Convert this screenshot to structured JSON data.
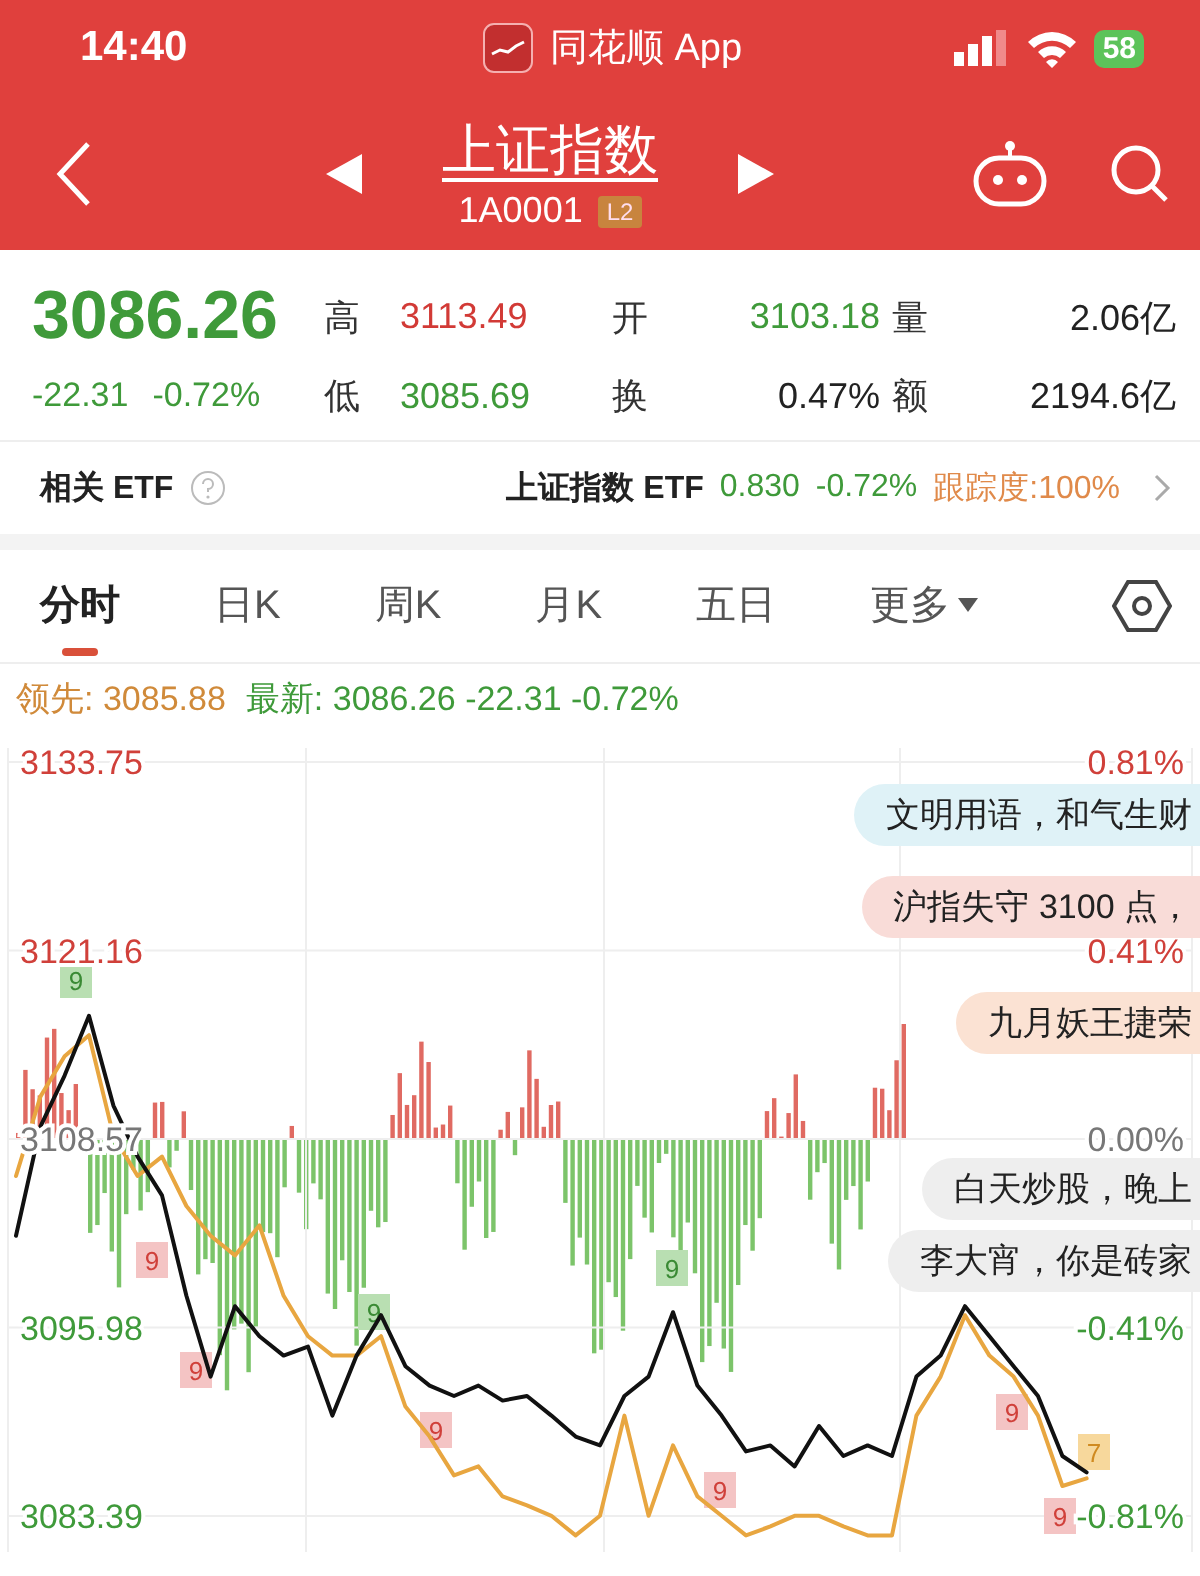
{
  "status_bar": {
    "time": "14:40",
    "app": "同花顺 App",
    "battery": "58"
  },
  "nav": {
    "title": "上证指数",
    "code": "1A0001",
    "badge": "L2"
  },
  "quote": {
    "price": "3086.26",
    "change": "-22.31",
    "change_pct": "-0.72%",
    "color": "#3f9a3a",
    "fields": [
      {
        "label": "高",
        "value": "3113.49",
        "color": "#d23a36"
      },
      {
        "label": "开",
        "value": "3103.18",
        "color": "#3f9a3a"
      },
      {
        "label": "量",
        "value": "2.06亿",
        "color": "#222222"
      },
      {
        "label": "低",
        "value": "3085.69",
        "color": "#3f9a3a"
      },
      {
        "label": "换",
        "value": "0.47%",
        "color": "#222222"
      },
      {
        "label": "额",
        "value": "2194.6亿",
        "color": "#222222"
      }
    ]
  },
  "etf": {
    "label": "相关 ETF",
    "name": "上证指数 ETF",
    "price": "0.830",
    "change_pct": "-0.72%",
    "tracking": "跟踪度:100%"
  },
  "tabs": [
    {
      "label": "分时",
      "selected": true,
      "kind": "tab"
    },
    {
      "label": "日K",
      "selected": false,
      "kind": "tab"
    },
    {
      "label": "周K",
      "selected": false,
      "kind": "tab"
    },
    {
      "label": "月K",
      "selected": false,
      "kind": "tab"
    },
    {
      "label": "五日",
      "selected": false,
      "kind": "tab"
    },
    {
      "label": "更多",
      "selected": false,
      "kind": "menu"
    }
  ],
  "chart": {
    "legend": [
      {
        "values": [
          "3085.88"
        ],
        "color": "#d08a3a"
      },
      {
        "values": [
          "3086.26",
          "-22.31",
          "-0.72%"
        ],
        "color": "#3f9a3a"
      }
    ],
    "pct_labels": [
      "0.81%",
      "0.41%",
      "0.00%",
      "-0.41%",
      "-0.81%"
    ],
    "markers": [
      {
        "label": "9",
        "color": "#b9dfb2"
      },
      {
        "label": "9",
        "color": "#f4c4c4"
      },
      {
        "label": "9",
        "color": "#f4c4c4"
      },
      {
        "label": "9",
        "color": "#b9dfb2"
      },
      {
        "label": "9",
        "color": "#f4c4c4"
      },
      {
        "label": "9",
        "color": "#b9dfb2"
      },
      {
        "label": "9",
        "color": "#f4c4c4"
      },
      {
        "label": "9",
        "color": "#f4c4c4"
      },
      {
        "label": "9",
        "color": "#f4c4c4"
      },
      {
        "label": "7",
        "color": "#f7d89c"
      }
    ],
    "comments": [
      {
        "text": "文明用语，和气生财",
        "color": "#dff2f7"
      },
      {
        "text": "沪指失守 3100 点，",
        "color": "#f9dcd8"
      },
      {
        "text": "九月妖王捷荣",
        "color": "#fbe2d3"
      },
      {
        "text": "白天炒股，晚上",
        "color": "#eeeeee"
      },
      {
        "text": "李大宵，你是砖家",
        "color": "#eeeeee"
      }
    ],
    "chart_data": {
      "type": "line",
      "grid": true,
      "ylim": [
        3081,
        3134.5
      ],
      "yticks": [
        {
          "value": 3133.75,
          "label": "3133.75"
        },
        {
          "value": 3121.16,
          "label": "3121.16"
        },
        {
          "value": 3108.57,
          "label": "3108.57"
        },
        {
          "value": 3095.98,
          "label": "3095.98"
        },
        {
          "value": 3083.39,
          "label": "3083.39"
        }
      ],
      "series": [
        {
          "name": "领先:",
          "color": "#e8a640",
          "values": [
            3106.1,
            3111.4,
            3114.1,
            3115.5,
            3108.8,
            3106.1,
            3107.4,
            3104.1,
            3102.1,
            3100.8,
            3102.8,
            3098.1,
            3095.4,
            3094.1,
            3094.1,
            3095.4,
            3090.7,
            3088.7,
            3086.1,
            3086.7,
            3084.7,
            3084.1,
            3083.4,
            3082.1,
            3083.4,
            3090.1,
            3083.4,
            3088.1,
            3084.7,
            3083.4,
            3082.1,
            3082.7,
            3083.4,
            3083.4,
            3082.7,
            3082.1,
            3082.1,
            3090.1,
            3092.7,
            3096.8,
            3094.1,
            3092.7,
            3090.1,
            3085.4,
            3085.9
          ]
        },
        {
          "name": "最新:",
          "color": "#111111",
          "values": [
            3102.1,
            3109.4,
            3112.8,
            3116.8,
            3110.8,
            3107.4,
            3104.8,
            3098.1,
            3092.7,
            3097.4,
            3095.4,
            3094.1,
            3094.7,
            3090.1,
            3094.1,
            3096.8,
            3093.4,
            3092.1,
            3091.4,
            3092.1,
            3091.1,
            3091.4,
            3090.1,
            3088.7,
            3088.1,
            3091.4,
            3092.7,
            3097.0,
            3092.1,
            3090.1,
            3087.7,
            3088.1,
            3086.7,
            3089.4,
            3087.4,
            3088.1,
            3087.4,
            3092.7,
            3094.1,
            3097.4,
            3095.4,
            3093.4,
            3091.4,
            3087.4,
            3086.3
          ]
        }
      ]
    }
  }
}
